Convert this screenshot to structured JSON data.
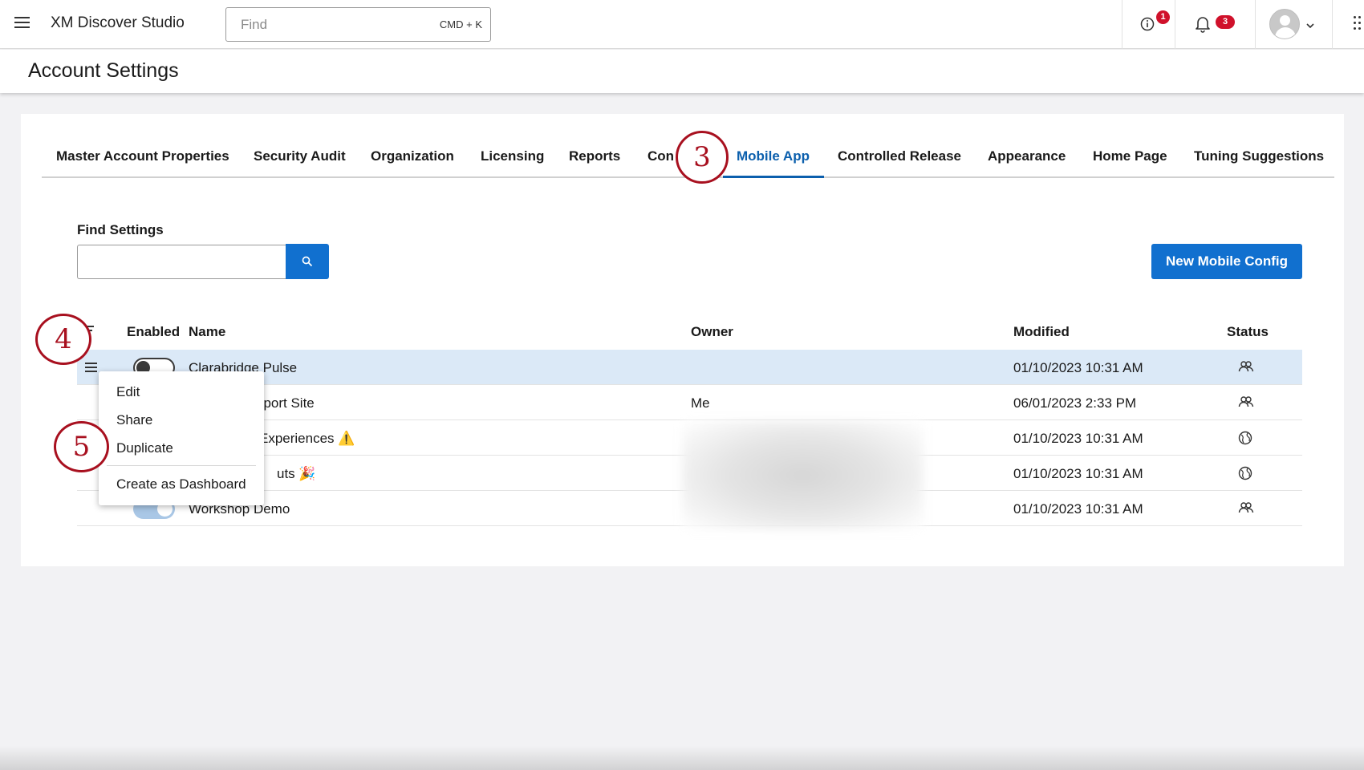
{
  "topbar": {
    "app_title": "XM Discover Studio",
    "find_placeholder": "Find",
    "find_shortcut": "CMD + K",
    "info_badge": "1",
    "notifications_badge": "3"
  },
  "page": {
    "title": "Account Settings"
  },
  "tabs": [
    {
      "label": "Master Account Properties"
    },
    {
      "label": "Security Audit"
    },
    {
      "label": "Organization"
    },
    {
      "label": "Licensing"
    },
    {
      "label": "Reports"
    },
    {
      "label": "Con"
    },
    {
      "label": "Mobile App",
      "active": true
    },
    {
      "label": "Controlled Release"
    },
    {
      "label": "Appearance"
    },
    {
      "label": "Home Page"
    },
    {
      "label": "Tuning Suggestions"
    }
  ],
  "find_settings": {
    "label": "Find Settings",
    "value": ""
  },
  "new_button": {
    "label": "New Mobile Config"
  },
  "table": {
    "headers": {
      "enabled": "Enabled",
      "name": "Name",
      "owner": "Owner",
      "modified": "Modified",
      "status": "Status"
    },
    "rows": [
      {
        "enabled": false,
        "name": "Clarabridge Pulse",
        "owner": "",
        "modified": "01/10/2023 10:31 AM",
        "status": "shared-users-icon"
      },
      {
        "name": "pport Site",
        "owner": "Me",
        "modified": "06/01/2023 2:33 PM",
        "status": "shared-users-icon"
      },
      {
        "name": "Experiences ⚠️",
        "owner": "",
        "modified": "01/10/2023 10:31 AM",
        "status": "public-globe-icon"
      },
      {
        "name": "uts 🎉",
        "owner": "",
        "modified": "01/10/2023 10:31 AM",
        "status": "public-globe-icon"
      },
      {
        "enabled": true,
        "name": "Workshop Demo",
        "owner": "",
        "modified": "01/10/2023 10:31 AM",
        "status": "shared-users-icon"
      }
    ]
  },
  "context_menu": {
    "items": [
      "Edit",
      "Share",
      "Duplicate",
      "Create as Dashboard"
    ]
  },
  "callouts": [
    "3",
    "4",
    "5"
  ],
  "colors": {
    "accent": "#1170cf",
    "active_tab": "#0b5fad",
    "badge": "#d0112b",
    "callout": "#a8101f",
    "selected_row": "#dbe9f7"
  }
}
